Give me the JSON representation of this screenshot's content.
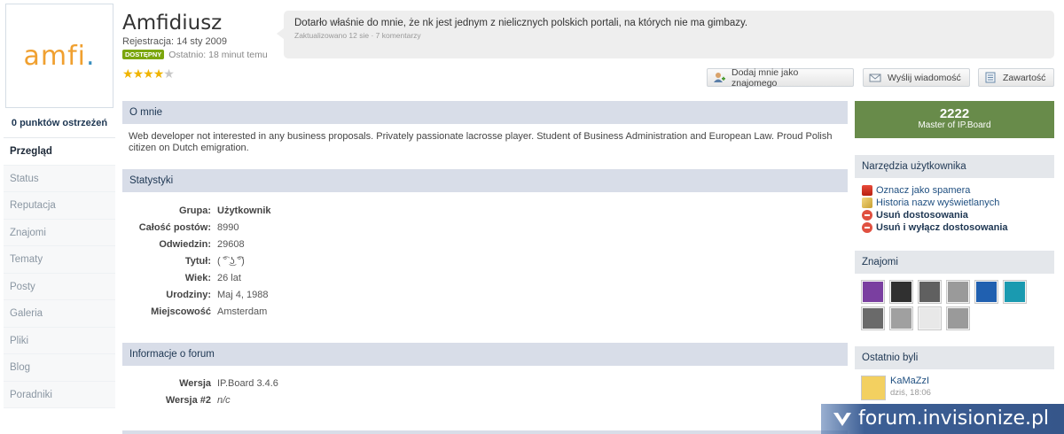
{
  "sidebar": {
    "logo_text": "amfi",
    "logo_dot": ".",
    "warnings": "0 punktów ostrzeżeń",
    "nav": [
      {
        "label": "Przegląd"
      },
      {
        "label": "Status"
      },
      {
        "label": "Reputacja"
      },
      {
        "label": "Znajomi"
      },
      {
        "label": "Tematy"
      },
      {
        "label": "Posty"
      },
      {
        "label": "Galeria"
      },
      {
        "label": "Pliki"
      },
      {
        "label": "Blog"
      },
      {
        "label": "Poradniki"
      }
    ]
  },
  "profile": {
    "name": "Amfidiusz",
    "registered": "Rejestracja: 14 sty 2009",
    "online_badge": "DOSTĘPNY",
    "last_active": "Ostatnio: 18 minut temu",
    "rating_stars": 4,
    "rating_max": 5
  },
  "status": {
    "text": "Dotarło właśnie do mnie, że nk jest jednym z nielicznych polskich portali, na których nie ma gimbazy.",
    "meta": "Zaktualizowano 12 sie · 7 komentarzy"
  },
  "buttons": {
    "add_friend": "Dodaj mnie jako znajomego",
    "send_message": "Wyślij wiadomość",
    "content": "Zawartość"
  },
  "about": {
    "heading": "O mnie",
    "text": "Web developer not interested in any business proposals. Privately passionate lacrosse player. Student of Business Administration and European Law. Proud Polish citizen on Dutch emigration."
  },
  "stats": {
    "heading": "Statystyki",
    "rows": [
      {
        "label": "Grupa:",
        "value": "Użytkownik"
      },
      {
        "label": "Całość postów:",
        "value": "8990"
      },
      {
        "label": "Odwiedzin:",
        "value": "29608"
      },
      {
        "label": "Tytuł:",
        "value": "( ͡° ͜ʖ ͡°)"
      },
      {
        "label": "Wiek:",
        "value": "26 lat"
      },
      {
        "label": "Urodziny:",
        "value": "Maj 4, 1988"
      },
      {
        "label": "Miejscowość",
        "value": "Amsterdam"
      }
    ]
  },
  "forum_info": {
    "heading": "Informacje o forum",
    "rows": [
      {
        "label": "Wersja",
        "value": "IP.Board 3.4.6"
      },
      {
        "label": "Wersja #2",
        "value": "n/c"
      }
    ]
  },
  "rank": {
    "points": "2222",
    "title": "Master of IP.Board"
  },
  "tools": {
    "heading": "Narzędzia użytkownika",
    "items": [
      {
        "label": "Oznacz jako spamera",
        "icon": "flag-icon"
      },
      {
        "label": "Historia nazw wyświetlanych",
        "icon": "pencil-icon"
      },
      {
        "label": "Usuń dostosowania",
        "icon": "delete-icon"
      },
      {
        "label": "Usuń i wyłącz dostosowania",
        "icon": "delete-icon"
      }
    ]
  },
  "friends": {
    "heading": "Znajomi",
    "colors": [
      "#7a3fa0",
      "#303030",
      "#606060",
      "#9a9a9a",
      "#2060b0",
      "#1a9ab0",
      "#6a6a6a",
      "#a0a0a0",
      "#e8e8e8",
      "#9a9a9a"
    ]
  },
  "last_visitors": {
    "heading": "Ostatnio byli",
    "name": "KaMaZzI",
    "time": "dziś, 18:06"
  },
  "watermark": "forum.invisionize.pl"
}
